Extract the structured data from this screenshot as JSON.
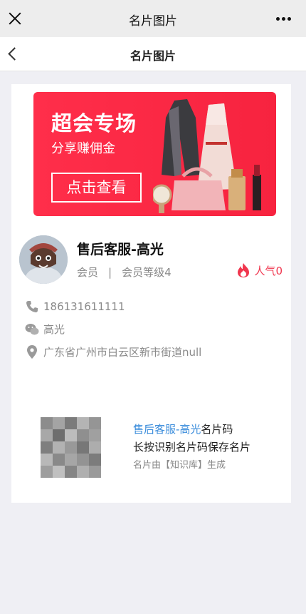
{
  "wechat_bar": {
    "title": "名片图片"
  },
  "nav": {
    "title": "名片图片"
  },
  "banner": {
    "title": "超会专场",
    "subtitle": "分享赚佣金",
    "button_label": "点击查看",
    "color": "#f7233f"
  },
  "profile": {
    "name": "售后客服-高光",
    "role": "会员",
    "separator": "|",
    "level": "会员等级4",
    "popularity": "人气0",
    "accent_color": "#f0364e"
  },
  "contact": {
    "phone": "186131611111",
    "wechat": "高光",
    "address": "广东省广州市白云区新市街道null"
  },
  "qr_section": {
    "name": "售后客服-高光",
    "suffix": "名片码",
    "instruction": "长按识别名片码保存名片",
    "footer": "名片由【知识库】生成",
    "highlight_color": "#3a8cdb"
  }
}
